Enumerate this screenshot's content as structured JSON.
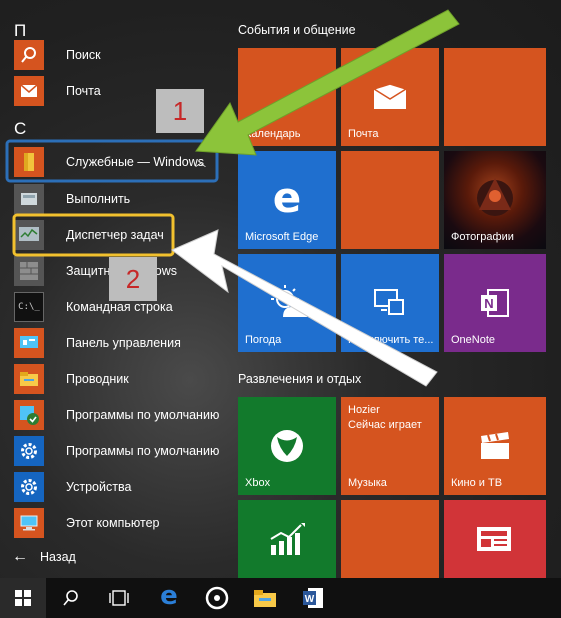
{
  "left": {
    "letter_p": "П",
    "letter_s": "С",
    "items": [
      {
        "label": "Поиск"
      },
      {
        "label": "Почта"
      },
      {
        "label": "Служебные — Windows"
      },
      {
        "label": "Выполнить"
      },
      {
        "label": "Диспетчер задач"
      },
      {
        "label": "Защитник Windows"
      },
      {
        "label": "Командная строка"
      },
      {
        "label": "Панель управления"
      },
      {
        "label": "Проводник"
      },
      {
        "label": "Программы по умолчанию"
      },
      {
        "label": "Программы по умолчанию"
      },
      {
        "label": "Устройства"
      },
      {
        "label": "Этот компьютер"
      }
    ],
    "back_label": "Назад"
  },
  "groups": {
    "social": "События и общение",
    "entertainment": "Развлечения и отдых"
  },
  "tiles": {
    "calendar": "Календарь",
    "mail": "Почта",
    "edge": "Microsoft Edge",
    "photos": "Фотографии",
    "weather": "Погода",
    "connect": "Подключить те...",
    "onenote": "OneNote",
    "xbox": "Xbox",
    "music_line1": "Hozier",
    "music_line2": "Сейчас играет",
    "music": "Музыка",
    "movies": "Кино и ТВ"
  },
  "annotations": {
    "n1": "1",
    "n2": "2"
  },
  "colors": {
    "tile_orange": "#d5541f",
    "tile_blue": "#1f6fcf",
    "tile_purple": "#7a2b8c",
    "tile_green": "#127a2c",
    "tile_red": "#d13438",
    "highlight_blue": "#2c6fb8",
    "highlight_yellow": "#f2c12e",
    "arrow_green": "#8cc43a"
  }
}
